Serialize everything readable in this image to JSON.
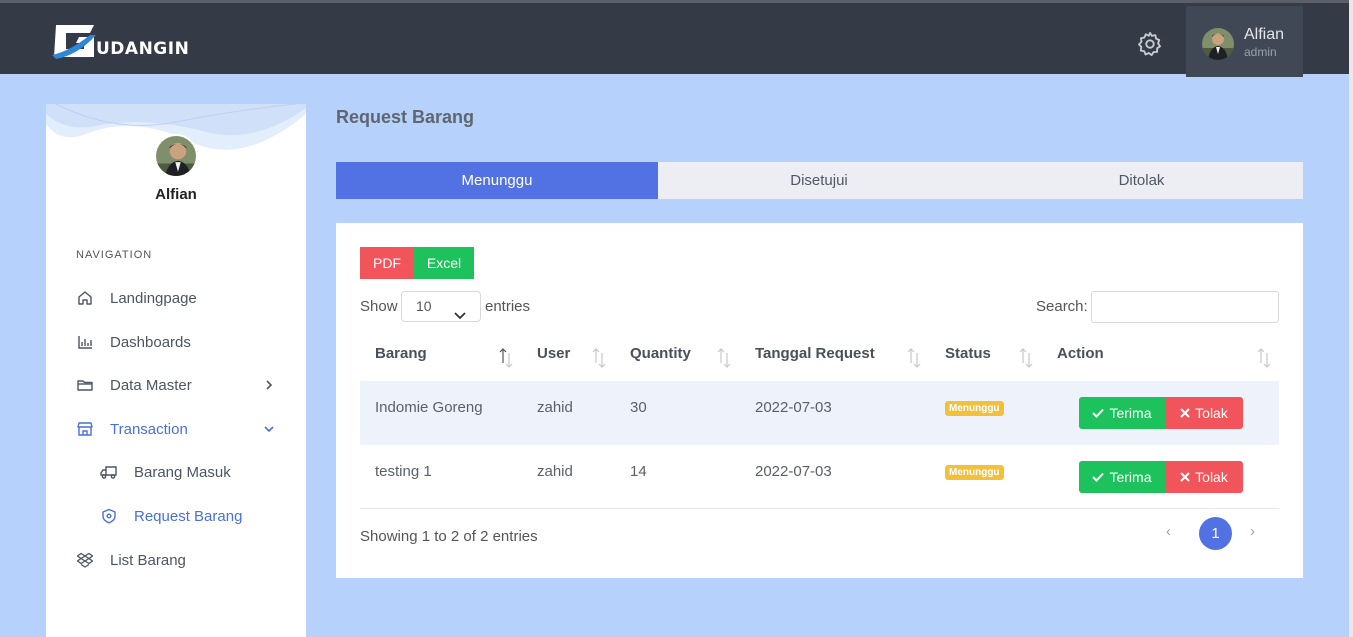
{
  "app": {
    "logo_text": "UDANGIN"
  },
  "header": {
    "user_name": "Alfian",
    "user_role": "admin",
    "settings_icon": "gear-icon"
  },
  "sidebar": {
    "profile_name": "Alfian",
    "nav_heading": "NAVIGATION",
    "items": [
      {
        "label": "Landingpage",
        "icon": "home-icon"
      },
      {
        "label": "Dashboards",
        "icon": "bar-chart-icon"
      },
      {
        "label": "Data Master",
        "icon": "folder-icon"
      },
      {
        "label": "Transaction",
        "icon": "store-icon"
      },
      {
        "label": "Barang Masuk",
        "icon": "truck-icon"
      },
      {
        "label": "Request Barang",
        "icon": "shield-icon"
      },
      {
        "label": "List Barang",
        "icon": "dropbox-icon"
      }
    ]
  },
  "main": {
    "title": "Request Barang",
    "tabs": [
      {
        "label": "Menunggu"
      },
      {
        "label": "Disetujui"
      },
      {
        "label": "Ditolak"
      }
    ],
    "export": {
      "pdf": "PDF",
      "excel": "Excel"
    },
    "length": {
      "show": "Show",
      "value": "10",
      "entries": "entries"
    },
    "search_label": "Search:",
    "columns": [
      "Barang",
      "User",
      "Quantity",
      "Tanggal Request",
      "Status",
      "Action"
    ],
    "rows": [
      {
        "barang": "Indomie Goreng",
        "user": "zahid",
        "quantity": "30",
        "tanggal": "2022-07-03",
        "status": "Menunggu",
        "accept": "Terima",
        "reject": "Tolak"
      },
      {
        "barang": "testing 1",
        "user": "zahid",
        "quantity": "14",
        "tanggal": "2022-07-03",
        "status": "Menunggu",
        "accept": "Terima",
        "reject": "Tolak"
      }
    ],
    "info": "Showing 1 to 2 of 2 entries",
    "pagination": {
      "prev": "‹",
      "page": "1",
      "next": "›"
    }
  },
  "colors": {
    "accent": "#5272e3",
    "success": "#1ec25c",
    "danger": "#f2545b",
    "warning": "#f3c039",
    "topbar": "#343a46",
    "background": "#b5d1fc"
  }
}
